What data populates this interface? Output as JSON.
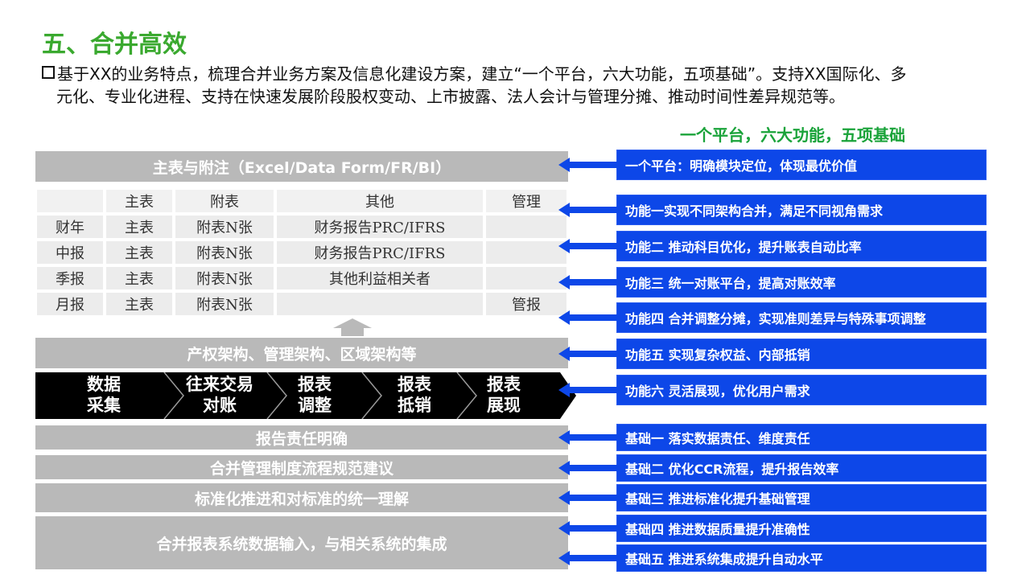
{
  "slide": {
    "title": "五、合并高效",
    "intro_line1": "基于XX的业务特点，梳理合并业务方案及信息化建设方案，建立“一个平台，六大功能，五项基础”。支持XX国际化、多",
    "intro_line2": "元化、专业化进程、支持在快速发展阶段股权变动、上市披露、法人会计与管理分摊、推动时间性差异规范等。",
    "right_title": "一个平台，六大功能，五项基础"
  },
  "left": {
    "top_bar": "主表与附注（Excel/Data Form/FR/BI）",
    "table": {
      "headers": [
        "",
        "主表",
        "附表",
        "其他",
        "管理"
      ],
      "rows": [
        [
          "财年",
          "主表",
          "附表N张",
          "财务报告PRC/IFRS",
          ""
        ],
        [
          "中报",
          "主表",
          "附表N张",
          "财务报告PRC/IFRS",
          ""
        ],
        [
          "季报",
          "主表",
          "附表N张",
          "其他利益相关者",
          ""
        ],
        [
          "月报",
          "主表",
          "附表N张",
          "",
          "管报"
        ]
      ]
    },
    "structure_bar": "产权架构、管理架构、区域架构等",
    "process_steps": [
      {
        "line1": "数据",
        "line2": "采集"
      },
      {
        "line1": "往来交易",
        "line2": "对账"
      },
      {
        "line1": "报表",
        "line2": "调整"
      },
      {
        "line1": "报表",
        "line2": "抵销"
      },
      {
        "line1": "报表",
        "line2": "展现"
      }
    ],
    "foundation_bars": [
      "报告责任明确",
      "合并管理制度流程规范建议",
      "标准化推进和对标准的统一理解",
      "合并报表系统数据输入，与相关系统的集成"
    ]
  },
  "right": {
    "platform": "一个平台：明确模块定位，体现最优价值",
    "functions": [
      "功能一实现不同架构合并，满足不同视角需求",
      "功能二 推动科目优化，提升账表自动比率",
      "功能三 统一对账平台，提高对账效率",
      "功能四 合并调整分摊，实现准则差异与特殊事项调整",
      "功能五 实现复杂权益、内部抵销",
      "功能六 灵活展现，优化用户需求"
    ],
    "foundations": [
      "基础一 落实数据责任、维度责任",
      "基础二 优化CCR流程，提升报告效率",
      "基础三 推进标准化提升基础管理",
      "基础四 推进数据质量提升准确性",
      "基础五 推进系统集成提升自动水平"
    ]
  },
  "colors": {
    "title_green": "#3aa92f",
    "right_title_green": "#1aa33a",
    "blue": "#0d47e8",
    "grey_bar": "#b9b9b9",
    "process_black": "#000000"
  }
}
